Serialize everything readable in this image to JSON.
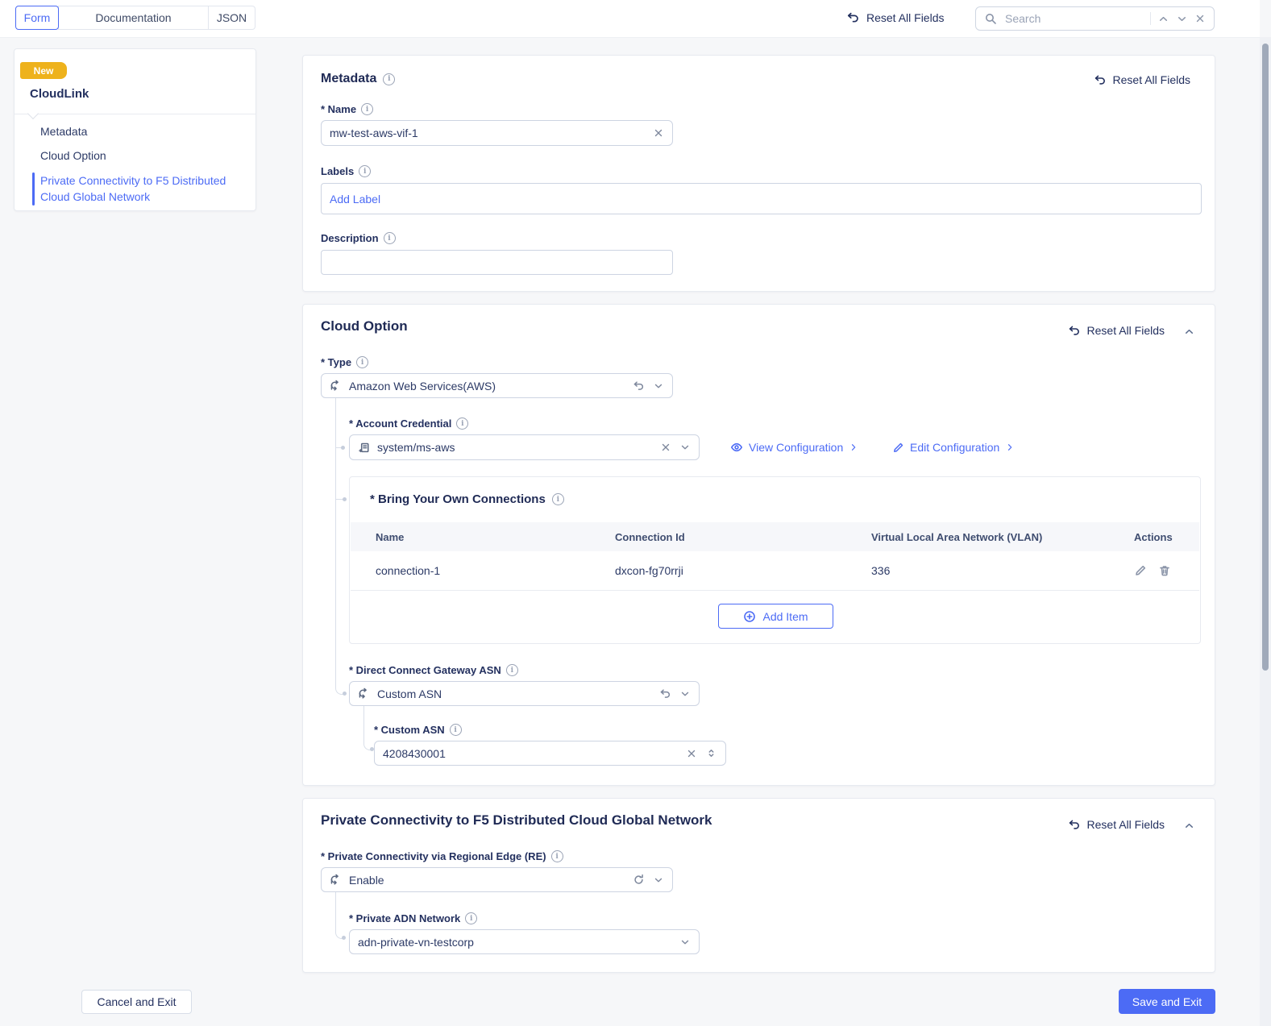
{
  "topbar": {
    "tabs": [
      {
        "label": "Form",
        "active": true
      },
      {
        "label": "Documentation",
        "active": false
      },
      {
        "label": "JSON",
        "active": false
      }
    ],
    "reset_all": "Reset All Fields",
    "search": {
      "placeholder": "Search"
    }
  },
  "sidebar": {
    "badge": "New",
    "title": "CloudLink",
    "items": [
      {
        "label": "Metadata",
        "active": false
      },
      {
        "label": "Cloud Option",
        "active": false
      },
      {
        "label": "Private Connectivity to F5 Distributed Cloud Global Network",
        "active": true
      }
    ]
  },
  "sections": {
    "metadata": {
      "title": "Metadata",
      "reset": "Reset All Fields",
      "name": {
        "label": "* Name",
        "value": "mw-test-aws-vif-1"
      },
      "labels": {
        "label": "Labels",
        "add_label": "Add Label"
      },
      "description": {
        "label": "Description",
        "value": ""
      }
    },
    "cloud_option": {
      "title": "Cloud Option",
      "reset": "Reset All Fields",
      "type": {
        "label": "* Type",
        "value": "Amazon Web Services(AWS)"
      },
      "account_credential": {
        "label": "* Account Credential",
        "value": "system/ms-aws"
      },
      "view_configuration": "View Configuration",
      "edit_configuration": "Edit Configuration",
      "byoc": {
        "title": "* Bring Your Own Connections",
        "columns": [
          "Name",
          "Connection Id",
          "Virtual Local Area Network (VLAN)",
          "Actions"
        ],
        "rows": [
          {
            "name": "connection-1",
            "connection_id": "dxcon-fg70rrji",
            "vlan": "336"
          }
        ],
        "add_item": "Add Item"
      },
      "dcg_asn": {
        "label": "* Direct Connect Gateway ASN",
        "value": "Custom ASN"
      },
      "custom_asn": {
        "label": "* Custom ASN",
        "value": "4208430001"
      }
    },
    "private_connectivity": {
      "title": "Private Connectivity to F5 Distributed Cloud Global Network",
      "reset": "Reset All Fields",
      "regional_edge": {
        "label": "* Private Connectivity via Regional Edge (RE)",
        "value": "Enable"
      },
      "adn_network": {
        "label": "* Private ADN Network",
        "value": "adn-private-vn-testcorp"
      }
    }
  },
  "footer": {
    "cancel": "Cancel and Exit",
    "save": "Save and Exit"
  },
  "colors": {
    "accent": "#4c6bf5",
    "navy": "#23305f",
    "badge_gold": "#eeb21c",
    "background": "#f6f7f9"
  }
}
